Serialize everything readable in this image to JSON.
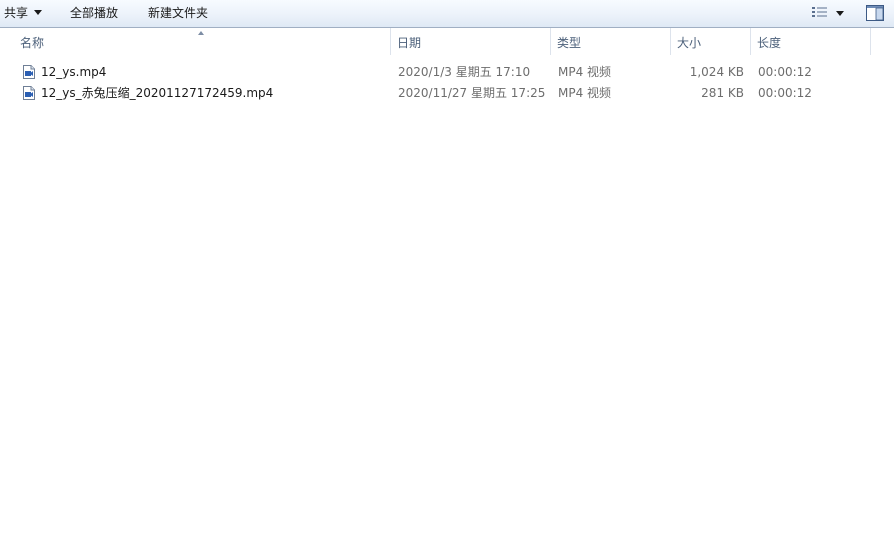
{
  "toolbar": {
    "share_label": "共享",
    "play_all_label": "全部播放",
    "new_folder_label": "新建文件夹"
  },
  "columns": {
    "name": "名称",
    "date": "日期",
    "type": "类型",
    "size": "大小",
    "length": "长度"
  },
  "files": [
    {
      "name": "12_ys.mp4",
      "date": "2020/1/3 星期五 17:10",
      "type": "MP4 视频",
      "size": "1,024 KB",
      "length": "00:00:12"
    },
    {
      "name": "12_ys_赤兔压缩_20201127172459.mp4",
      "date": "2020/11/27 星期五 17:25",
      "type": "MP4 视频",
      "size": "281 KB",
      "length": "00:00:12"
    }
  ],
  "icons": {
    "file": "video-file-icon",
    "views": "view-options-icon",
    "preview_pane": "preview-pane-icon"
  },
  "colors": {
    "toolbar_top": "#f7fbff",
    "toolbar_bottom": "#dfe9f5",
    "header_text": "#4c607a",
    "detail_text": "#6d6d6d"
  }
}
